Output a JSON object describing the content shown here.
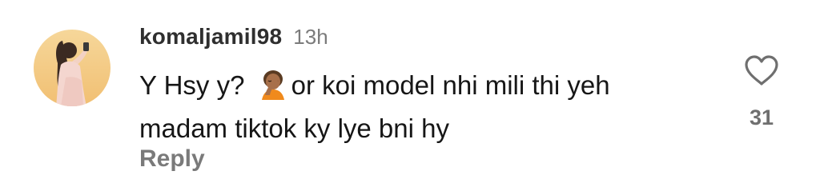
{
  "comment": {
    "username": "komaljamil98",
    "time_ago": "13h",
    "text_line1_before_emoji": "Y Hsy y? ",
    "emoji_icon": "person-facepalming-emoji",
    "text_line1_after_emoji": "or koi model nhi mili thi yeh",
    "text_line2": "madam tiktok ky lye bni hy",
    "reply_label": "Reply",
    "like_icon": "heart-outline-icon",
    "like_count": "31",
    "avatar_icon": "user-avatar-photo"
  },
  "colors": {
    "username": "#2f2f2f",
    "secondary_text": "#7b7b7b",
    "body_text": "#161616",
    "icon_gray": "#6f6f6f"
  }
}
